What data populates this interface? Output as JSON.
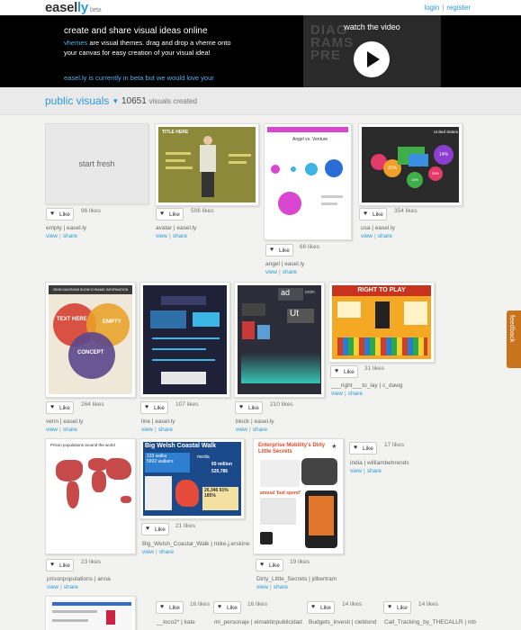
{
  "header": {
    "logo_main": "easel",
    "logo_ly": "ly",
    "logo_beta": "beta",
    "login": "login",
    "register": "register"
  },
  "hero": {
    "title": "create and share visual ideas online",
    "desc_highlight": "vhemes",
    "desc_rest": " are visual themes. drag and drop a vheme onto your canvas for easy creation of your visual idea!",
    "beta_note": "easel.ly is currently in beta but we would love your",
    "video_title": "watch the video",
    "video_bg_text": "DIAG\nRAMS\nPRE"
  },
  "subheader": {
    "public_visuals": "public visuals",
    "count": "10651",
    "count_label": "visuals created"
  },
  "start_fresh": "start fresh",
  "like_label": "Like",
  "view_label": "view",
  "share_label": "share",
  "feedback": "feedback",
  "tiles": [
    {
      "likes": "96 likes",
      "caption": "empty | easel.ly"
    },
    {
      "likes": "506 likes",
      "caption": "avatar | easel.ly"
    },
    {
      "likes": "66 likes",
      "caption": "angel | easel.ly"
    },
    {
      "likes": "354 likes",
      "caption": "usa | easel.ly"
    },
    {
      "likes": "264 likes",
      "caption": "venn | easel.ly"
    },
    {
      "likes": "107 likes",
      "caption": "line | easel.ly"
    },
    {
      "likes": "210 likes",
      "caption": "block | easel.ly"
    },
    {
      "likes": "31 likes",
      "caption": "___right___to_lay | c_dawg"
    },
    {
      "likes": "23 likes",
      "caption": "prisonpopulations | anna"
    },
    {
      "likes": "21 likes",
      "caption": "Big_Welsh_Coastal_Walk | mike.j.erskine"
    },
    {
      "likes": "19 likes",
      "caption": "Dirty_Little_Secrets | jdbertram"
    },
    {
      "likes": "17 likes",
      "caption": "india | williambehrends"
    },
    {
      "likes": "16 likes",
      "caption": "__loco2* | kate"
    },
    {
      "likes": "16 likes",
      "caption": "mi_personaje | elmaktinpublicidad"
    },
    {
      "likes": "14 likes",
      "caption": "Budgets_investi | cleblond"
    },
    {
      "likes": "14 likes",
      "caption": "Call_Tracking_by_THECALLR | mb"
    }
  ],
  "thumb_text": {
    "avatar_title": "TITLE HERE",
    "angel_title": "Angel vs. Venture",
    "usa_title": "United States",
    "usa_pcts": [
      "31%",
      "14%",
      "26%",
      "14%"
    ],
    "venn_title": "VENN DIAGRAMS SHOW DYNAMIC INFORMATION",
    "venn_a": "TEXT HERE",
    "venn_b": "EMPTY",
    "venn_c": "CONCEPT",
    "block_words": [
      "ad",
      "enim",
      "Ut"
    ],
    "right_title": "RIGHT TO PLAY",
    "prison_title": "Prison populations around the world",
    "welsh_title": "Big Welsh Coastal Walk",
    "welsh_stats": [
      "133 walks",
      "5692 walkers",
      "media",
      "69 million",
      "520,786",
      "26,346",
      "61%",
      "185%"
    ],
    "dirty_title": "Enterprise Mobility's Dirty Little Secrets",
    "dirty_sub": "annual 'bud spend'"
  },
  "colors": {
    "accent": "#2b9ad6",
    "hero_bg": "#000000",
    "feedback": "#c9731d"
  }
}
